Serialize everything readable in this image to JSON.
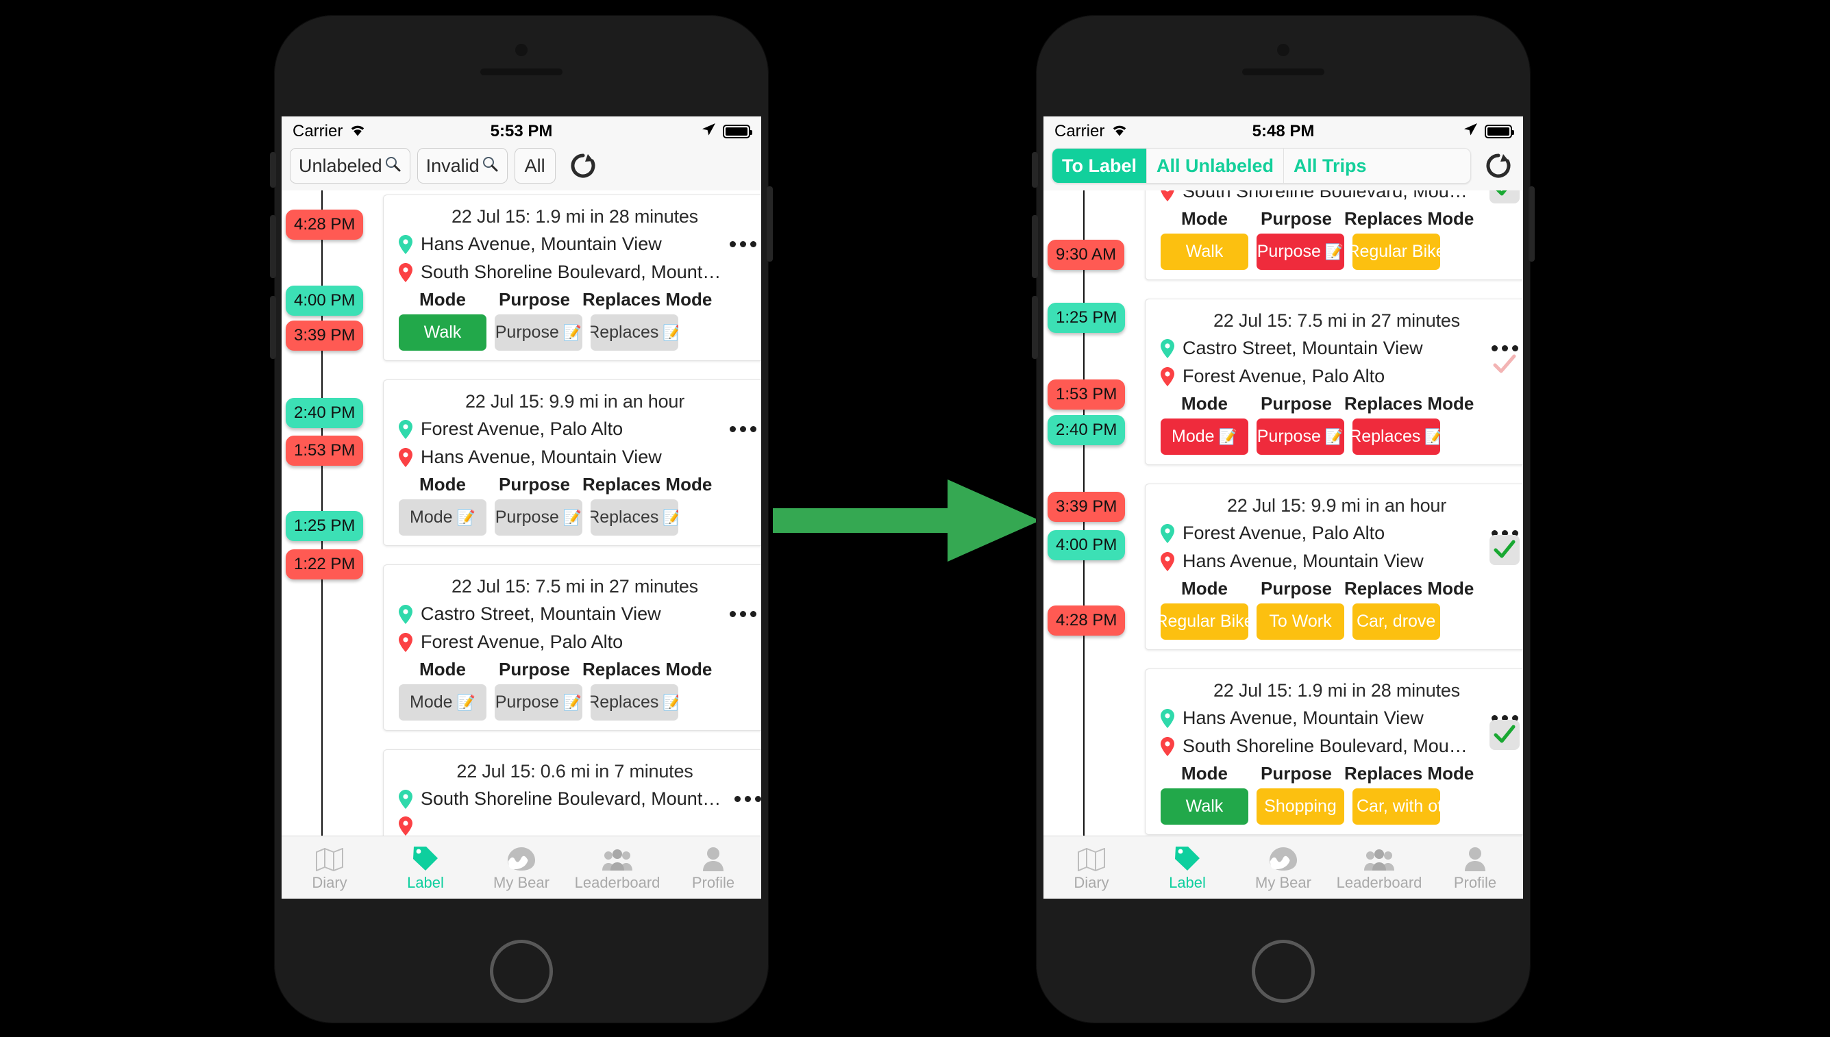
{
  "colors": {
    "teal": "#12d09c",
    "teal_chip": "#3ce0b5",
    "red_chip": "#ff5a53",
    "green_btn": "#22a84a",
    "yellow_btn": "#fcc010",
    "red_btn": "#ef2b3c",
    "grey_btn": "#dcdcdc",
    "arrow_green": "#35a852"
  },
  "arrow": {
    "name": "right-arrow"
  },
  "left_phone": {
    "status": {
      "carrier": "Carrier",
      "time": "5:53 PM",
      "wifi_icon": "wifi-icon",
      "location_icon": "location-arrow-icon",
      "battery_icon": "battery-icon"
    },
    "toolbar": {
      "buttons": [
        {
          "label": "Unlabeled",
          "icon": "magnifier-icon",
          "style": "plain"
        },
        {
          "label": "Invalid",
          "icon": "magnifier-icon",
          "style": "plain"
        },
        {
          "label": "All",
          "icon": "",
          "style": "plain"
        }
      ],
      "refresh_icon": "refresh-icon"
    },
    "timeline": [
      {
        "time": "4:28 PM",
        "color": "red"
      },
      {
        "time": "4:00 PM",
        "color": "green"
      },
      {
        "time": "3:39 PM",
        "color": "red"
      },
      {
        "time": "2:40 PM",
        "color": "green"
      },
      {
        "time": "1:53 PM",
        "color": "red"
      },
      {
        "time": "1:25 PM",
        "color": "green"
      },
      {
        "time": "1:22 PM",
        "color": "red"
      }
    ],
    "column_headers": {
      "mode": "Mode",
      "purpose": "Purpose",
      "replaces": "Replaces Mode"
    },
    "cards": [
      {
        "title": "22 Jul 15: 1.9 mi in 28 minutes",
        "start": "Hans Avenue, Mountain View",
        "end": "South Shoreline Boulevard, Mount…",
        "menu_icon": "more-options-icon",
        "mode": {
          "label": "Walk",
          "style": "green",
          "pencil": false
        },
        "purpose": {
          "label": "Purpose",
          "style": "grey",
          "pencil": true
        },
        "replaces": {
          "label": "Replaces",
          "style": "grey",
          "pencil": true
        }
      },
      {
        "title": "22 Jul 15: 9.9 mi in an hour",
        "start": "Forest Avenue, Palo Alto",
        "end": "Hans Avenue, Mountain View",
        "menu_icon": "more-options-icon",
        "mode": {
          "label": "Mode",
          "style": "grey",
          "pencil": true
        },
        "purpose": {
          "label": "Purpose",
          "style": "grey",
          "pencil": true
        },
        "replaces": {
          "label": "Replaces",
          "style": "grey",
          "pencil": true
        }
      },
      {
        "title": "22 Jul 15: 7.5 mi in 27 minutes",
        "start": "Castro Street, Mountain View",
        "end": "Forest Avenue, Palo Alto",
        "menu_icon": "more-options-icon",
        "mode": {
          "label": "Mode",
          "style": "grey",
          "pencil": true
        },
        "purpose": {
          "label": "Purpose",
          "style": "grey",
          "pencil": true
        },
        "replaces": {
          "label": "Replaces",
          "style": "grey",
          "pencil": true
        }
      },
      {
        "title": "22 Jul 15: 0.6 mi in 7 minutes",
        "start": "South Shoreline Boulevard, Mount…",
        "end": "",
        "menu_icon": "more-options-icon",
        "mode": null,
        "purpose": null,
        "replaces": null
      }
    ],
    "tabs": [
      {
        "label": "Diary",
        "icon": "map-icon",
        "active": false
      },
      {
        "label": "Label",
        "icon": "tag-icon",
        "active": true
      },
      {
        "label": "My Bear",
        "icon": "bear-icon",
        "active": false
      },
      {
        "label": "Leaderboard",
        "icon": "people-icon",
        "active": false
      },
      {
        "label": "Profile",
        "icon": "person-icon",
        "active": false
      }
    ]
  },
  "right_phone": {
    "status": {
      "carrier": "Carrier",
      "time": "5:48 PM",
      "wifi_icon": "wifi-icon",
      "location_icon": "location-arrow-icon",
      "battery_icon": "battery-icon"
    },
    "toolbar": {
      "segments": [
        {
          "label": "To Label",
          "active": true
        },
        {
          "label": "All Unlabeled",
          "active": false
        },
        {
          "label": "All Trips",
          "active": false
        }
      ],
      "refresh_icon": "refresh-icon"
    },
    "timeline": [
      {
        "time": "9:30 AM",
        "color": "red"
      },
      {
        "time": "1:25 PM",
        "color": "green"
      },
      {
        "time": "1:53 PM",
        "color": "red"
      },
      {
        "time": "2:40 PM",
        "color": "green"
      },
      {
        "time": "3:39 PM",
        "color": "red"
      },
      {
        "time": "4:00 PM",
        "color": "green"
      },
      {
        "time": "4:28 PM",
        "color": "red"
      }
    ],
    "column_headers": {
      "mode": "Mode",
      "purpose": "Purpose",
      "replaces": "Replaces Mode"
    },
    "cards": [
      {
        "title": "",
        "start": "",
        "end": "South Shoreline Boulevard, Mou…",
        "menu_icon": "more-options-icon",
        "check": "partial",
        "mode": {
          "label": "Walk",
          "style": "yellow",
          "pencil": false
        },
        "purpose": {
          "label": "Purpose",
          "style": "red",
          "pencil": true
        },
        "replaces": {
          "label": "Regular Bike",
          "style": "yellow",
          "pencil": false
        }
      },
      {
        "title": "22 Jul 15: 7.5 mi in 27 minutes",
        "start": "Castro Street, Mountain View",
        "end": "Forest Avenue, Palo Alto",
        "menu_icon": "more-options-icon",
        "check": "faded",
        "mode": {
          "label": "Mode",
          "style": "red",
          "pencil": true
        },
        "purpose": {
          "label": "Purpose",
          "style": "red",
          "pencil": true
        },
        "replaces": {
          "label": "Replaces",
          "style": "red",
          "pencil": true
        }
      },
      {
        "title": "22 Jul 15: 9.9 mi in an hour",
        "start": "Forest Avenue, Palo Alto",
        "end": "Hans Avenue, Mountain View",
        "menu_icon": "more-options-icon",
        "check": "done",
        "mode": {
          "label": "Regular Bike",
          "style": "yellow",
          "pencil": false
        },
        "purpose": {
          "label": "To Work",
          "style": "yellow",
          "pencil": false
        },
        "replaces": {
          "label": "Car, drove alo",
          "style": "yellow",
          "pencil": false
        }
      },
      {
        "title": "22 Jul 15: 1.9 mi in 28 minutes",
        "start": "Hans Avenue, Mountain View",
        "end": "South Shoreline Boulevard, Mou…",
        "menu_icon": "more-options-icon",
        "check": "done",
        "mode": {
          "label": "Walk",
          "style": "green",
          "pencil": false
        },
        "purpose": {
          "label": "Shopping",
          "style": "yellow",
          "pencil": false
        },
        "replaces": {
          "label": "Car, with othe",
          "style": "yellow",
          "pencil": false
        }
      }
    ],
    "tabs": [
      {
        "label": "Diary",
        "icon": "map-icon",
        "active": false
      },
      {
        "label": "Label",
        "icon": "tag-icon",
        "active": true
      },
      {
        "label": "My Bear",
        "icon": "bear-icon",
        "active": false
      },
      {
        "label": "Leaderboard",
        "icon": "people-icon",
        "active": false
      },
      {
        "label": "Profile",
        "icon": "person-icon",
        "active": false
      }
    ]
  }
}
